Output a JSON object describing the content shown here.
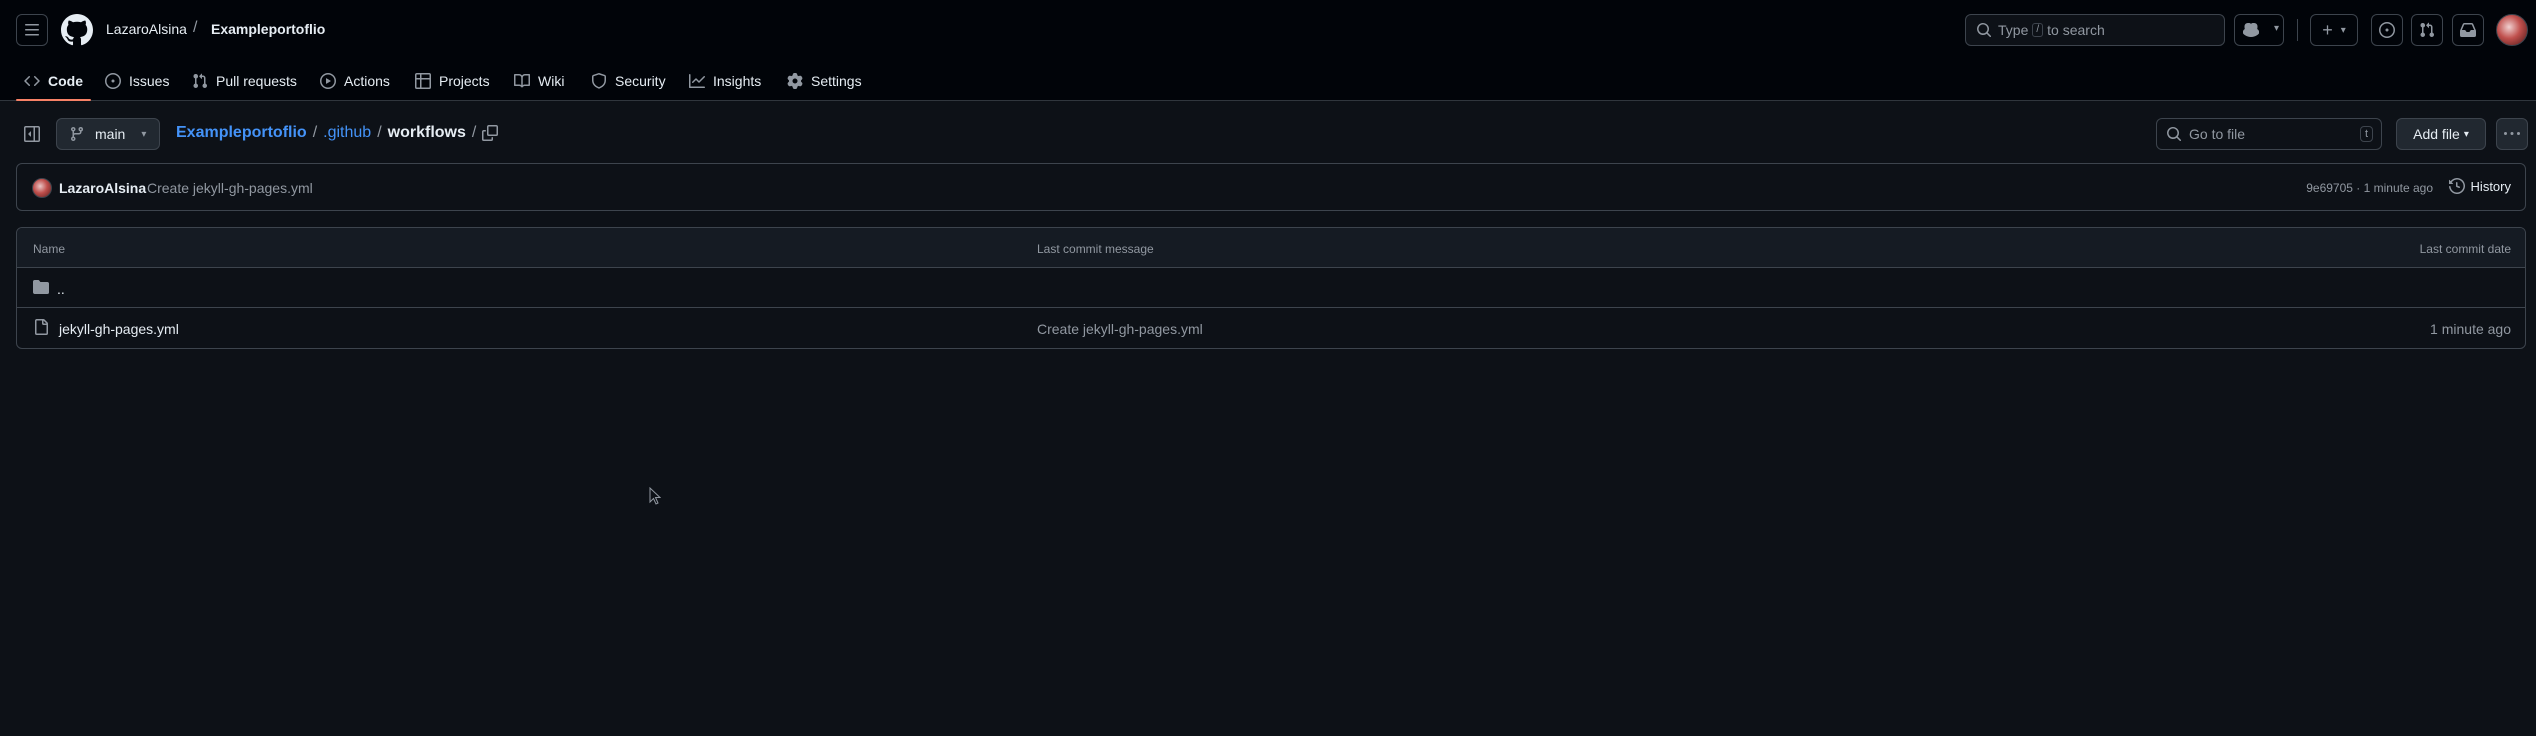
{
  "header": {
    "owner": "LazaroAlsina",
    "separator": "/",
    "repo": "Exampleportoflio",
    "search": {
      "prefix": "Type",
      "key": "/",
      "suffix": "to search"
    }
  },
  "tabs": [
    {
      "label": "Code",
      "icon": "code-icon",
      "active": true
    },
    {
      "label": "Issues",
      "icon": "issue-opened-icon"
    },
    {
      "label": "Pull requests",
      "icon": "git-pull-request-icon"
    },
    {
      "label": "Actions",
      "icon": "play-icon"
    },
    {
      "label": "Projects",
      "icon": "table-icon"
    },
    {
      "label": "Wiki",
      "icon": "book-icon"
    },
    {
      "label": "Security",
      "icon": "shield-icon"
    },
    {
      "label": "Insights",
      "icon": "graph-icon"
    },
    {
      "label": "Settings",
      "icon": "gear-icon"
    }
  ],
  "toolbar": {
    "branch": "main",
    "path": {
      "root": "Exampleportoflio",
      "dir": ".github",
      "current": "workflows",
      "sep": "/"
    },
    "goto_placeholder": "Go to file",
    "goto_key": "t",
    "add_file": "Add file"
  },
  "commit": {
    "author": "LazaroAlsina",
    "message": "Create jekyll-gh-pages.yml",
    "meta": "9e69705 · 1 minute ago",
    "history": "History"
  },
  "table": {
    "headers": {
      "name": "Name",
      "message": "Last commit message",
      "date": "Last commit date"
    },
    "parent": "..",
    "rows": [
      {
        "name": "jekyll-gh-pages.yml",
        "message": "Create jekyll-gh-pages.yml",
        "date": "1 minute ago"
      }
    ]
  },
  "colors": {
    "accent": "#f78166",
    "link": "#4493f8",
    "bg": "#0d1117",
    "header_bg": "#010409"
  }
}
